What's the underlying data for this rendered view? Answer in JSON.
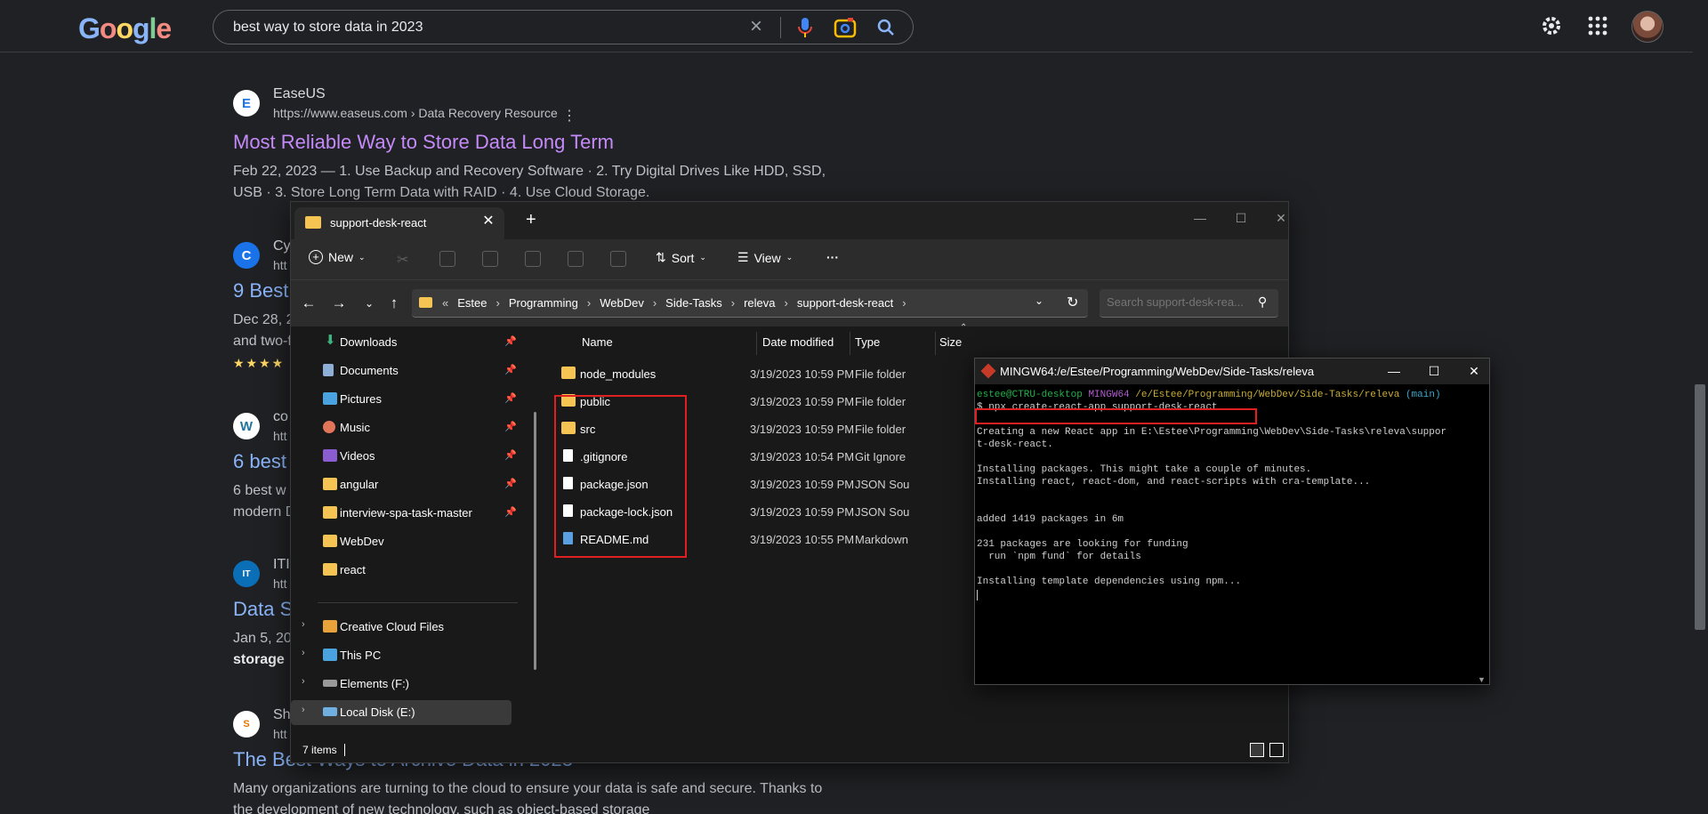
{
  "google": {
    "logo_letters": [
      "G",
      "o",
      "o",
      "g",
      "l",
      "e"
    ],
    "search_value": "best way to store data in 2023",
    "icons": [
      "close-icon",
      "mic-icon",
      "lens-icon",
      "search-icon",
      "gear-icon",
      "apps-icon",
      "avatar"
    ]
  },
  "results": [
    {
      "site": "EaseUS",
      "url": "https://www.easeus.com › Data Recovery Resource",
      "title": "Most Reliable Way to Store Data Long Term",
      "snippet_1": "Feb 22, 2023 — 1. Use Backup and Recovery Software · 2. Try Digital Drives Like HDD, SSD,",
      "snippet_2": "USB · 3. Store Long Term Data with RAID · 4. Use Cloud Storage.",
      "favicon": "E"
    },
    {
      "site": "Cy",
      "url": "htt",
      "title": "9 Best",
      "snippet_1": "Dec 28, 2",
      "snippet_2": "and two-f",
      "stars": "★★★★",
      "favicon": "C"
    },
    {
      "site": "co",
      "url": "htt",
      "title": "6 best",
      "snippet_1": "6 best w",
      "snippet_2": "modern D",
      "favicon": "W"
    },
    {
      "site": "ITI",
      "url": "htt",
      "title": "Data S",
      "snippet_1": "Jan 5, 20",
      "snippet_2": "storage",
      "favicon": "IT"
    },
    {
      "site": "Sh",
      "url": "htt",
      "title": "The Best Ways to Archive Data in 2023",
      "snippet_1": "Many organizations are turning to the cloud to ensure your data is safe and secure. Thanks to",
      "snippet_2": "the development of new technology, such as object-based storage",
      "favicon": "S"
    }
  ],
  "explorer": {
    "tab_title": "support-desk-react",
    "toolbar": {
      "new": "New",
      "sort": "Sort",
      "view": "View",
      "more": "···"
    },
    "breadcrumbs": [
      "Estee",
      "Programming",
      "WebDev",
      "Side-Tasks",
      "releva",
      "support-desk-react"
    ],
    "search_placeholder": "Search support-desk-rea...",
    "nav_items": [
      {
        "label": "Downloads",
        "pinned": true
      },
      {
        "label": "Documents",
        "pinned": true
      },
      {
        "label": "Pictures",
        "pinned": true
      },
      {
        "label": "Music",
        "pinned": true
      },
      {
        "label": "Videos",
        "pinned": true
      },
      {
        "label": "angular",
        "pinned": true
      },
      {
        "label": "interview-spa-task-master",
        "pinned": true
      },
      {
        "label": "WebDev",
        "pinned": false
      },
      {
        "label": "react",
        "pinned": false
      },
      {
        "label": "Creative Cloud Files",
        "pinned": false
      },
      {
        "label": "This PC",
        "pinned": false
      },
      {
        "label": "Elements (F:)",
        "pinned": false
      },
      {
        "label": "Local Disk (E:)",
        "pinned": false
      }
    ],
    "columns": {
      "name": "Name",
      "date": "Date modified",
      "type": "Type",
      "size": "Size"
    },
    "files": [
      {
        "name": "node_modules",
        "date": "3/19/2023 10:59 PM",
        "type": "File folder",
        "kind": "folder"
      },
      {
        "name": "public",
        "date": "3/19/2023 10:59 PM",
        "type": "File folder",
        "kind": "folder"
      },
      {
        "name": "src",
        "date": "3/19/2023 10:59 PM",
        "type": "File folder",
        "kind": "folder"
      },
      {
        "name": ".gitignore",
        "date": "3/19/2023 10:54 PM",
        "type": "Git Ignore",
        "kind": "doc"
      },
      {
        "name": "package.json",
        "date": "3/19/2023 10:59 PM",
        "type": "JSON Sou",
        "kind": "doc"
      },
      {
        "name": "package-lock.json",
        "date": "3/19/2023 10:59 PM",
        "type": "JSON Sou",
        "kind": "doc"
      },
      {
        "name": "README.md",
        "date": "3/19/2023 10:55 PM",
        "type": "Markdown",
        "kind": "doc"
      }
    ],
    "status": "7 items"
  },
  "terminal": {
    "title": "MINGW64:/e/Estee/Programming/WebDev/Side-Tasks/releva",
    "prompt_user": "estee@CTRU-desktop",
    "prompt_env": "MINGW64",
    "prompt_path": "/e/Estee/Programming/WebDev/Side-Tasks/releva",
    "prompt_branch": "(main)",
    "command": "$ npx create-react-app support-desk-react",
    "lines": [
      "Creating a new React app in E:\\Estee\\Programming\\WebDev\\Side-Tasks\\releva\\suppor",
      "t-desk-react.",
      "",
      "Installing packages. This might take a couple of minutes.",
      "Installing react, react-dom, and react-scripts with cra-template...",
      "",
      "",
      "added 1419 packages in 6m",
      "",
      "231 packages are looking for funding",
      "  run `npm fund` for details",
      "",
      "Installing template dependencies using npm..."
    ]
  },
  "colors": {
    "visited_link": "#c58af9",
    "link": "#8ab4f8",
    "folder": "#f5c453",
    "highlight_box": "#e02020"
  }
}
